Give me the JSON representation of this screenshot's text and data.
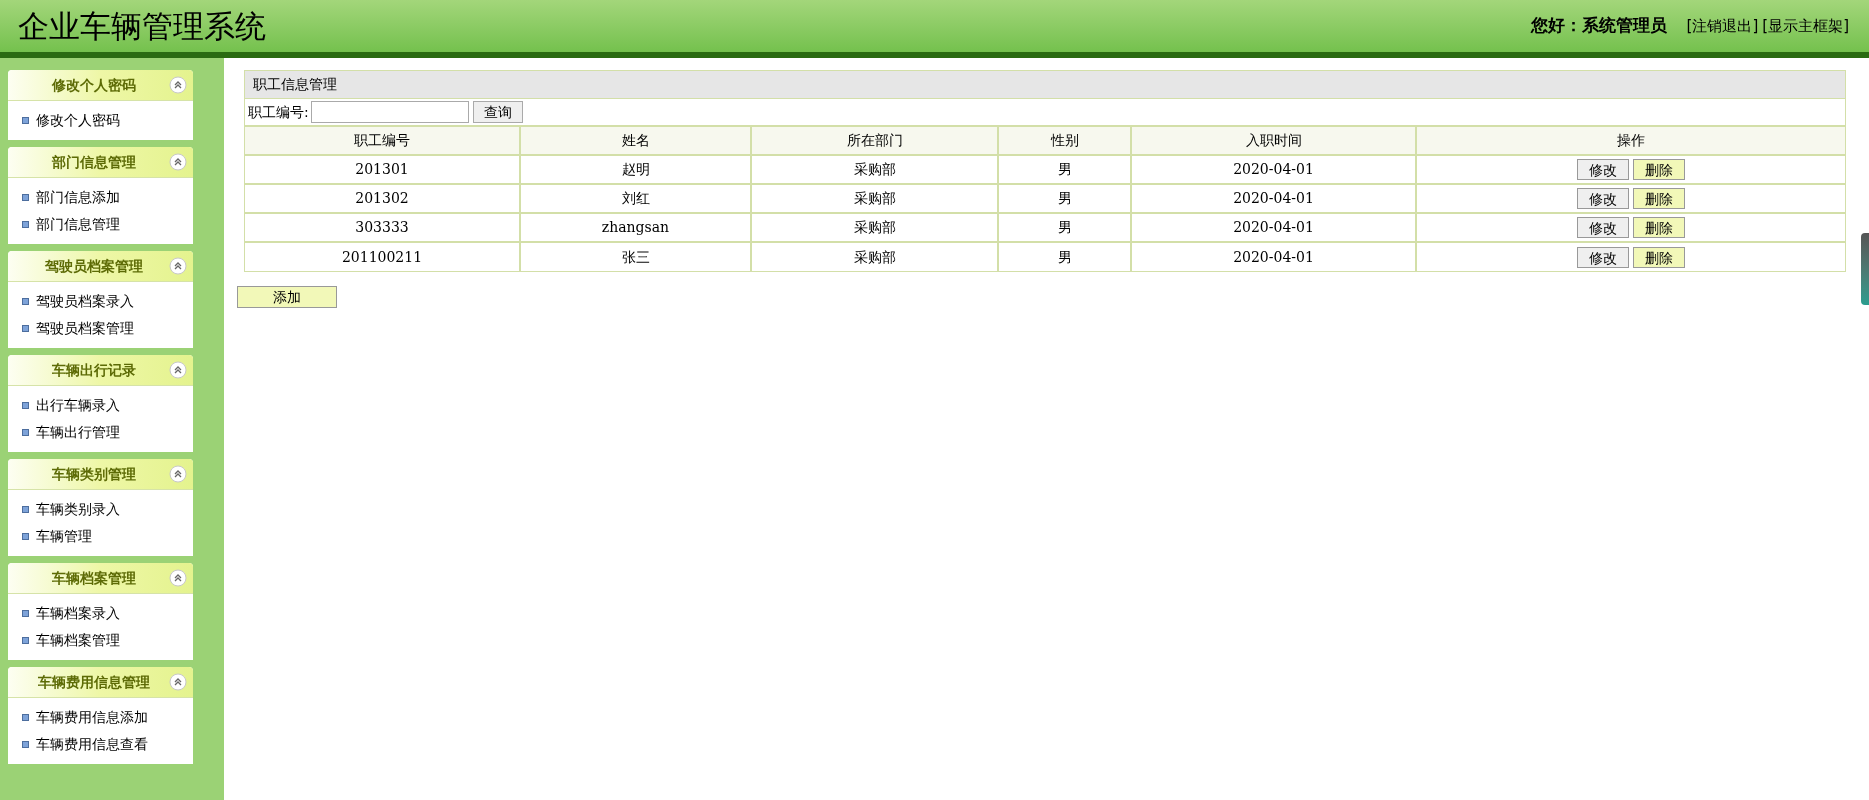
{
  "header": {
    "title": "企业车辆管理系统",
    "greeting": "您好：",
    "user": "系统管理员",
    "links": [
      "[注销退出]",
      "[显示主框架]"
    ]
  },
  "sidebar": [
    {
      "title": "修改个人密码",
      "items": [
        "修改个人密码"
      ]
    },
    {
      "title": "部门信息管理",
      "items": [
        "部门信息添加",
        "部门信息管理"
      ]
    },
    {
      "title": "驾驶员档案管理",
      "items": [
        "驾驶员档案录入",
        "驾驶员档案管理"
      ]
    },
    {
      "title": "车辆出行记录",
      "items": [
        "出行车辆录入",
        "车辆出行管理"
      ]
    },
    {
      "title": "车辆类别管理",
      "items": [
        "车辆类别录入",
        "车辆管理"
      ]
    },
    {
      "title": "车辆档案管理",
      "items": [
        "车辆档案录入",
        "车辆档案管理"
      ]
    },
    {
      "title": "车辆费用信息管理",
      "items": [
        "车辆费用信息添加",
        "车辆费用信息查看"
      ]
    }
  ],
  "panel": {
    "title": "职工信息管理",
    "search_label": "职工编号:",
    "search_button": "查询",
    "columns": [
      "职工编号",
      "姓名",
      "所在部门",
      "性别",
      "入职时间",
      "操作"
    ],
    "rows": [
      {
        "cells": [
          "201301",
          "赵明",
          "采购部",
          "男",
          "2020-04-01"
        ],
        "actions": [
          "修改",
          "删除"
        ]
      },
      {
        "cells": [
          "201302",
          "刘红",
          "采购部",
          "男",
          "2020-04-01"
        ],
        "actions": [
          "修改",
          "删除"
        ]
      },
      {
        "cells": [
          "303333",
          "zhangsan",
          "采购部",
          "男",
          "2020-04-01"
        ],
        "actions": [
          "修改",
          "删除"
        ]
      },
      {
        "cells": [
          "201100211",
          "张三",
          "采购部",
          "男",
          "2020-04-01"
        ],
        "actions": [
          "修改",
          "删除"
        ]
      }
    ],
    "add_button": "添加"
  }
}
